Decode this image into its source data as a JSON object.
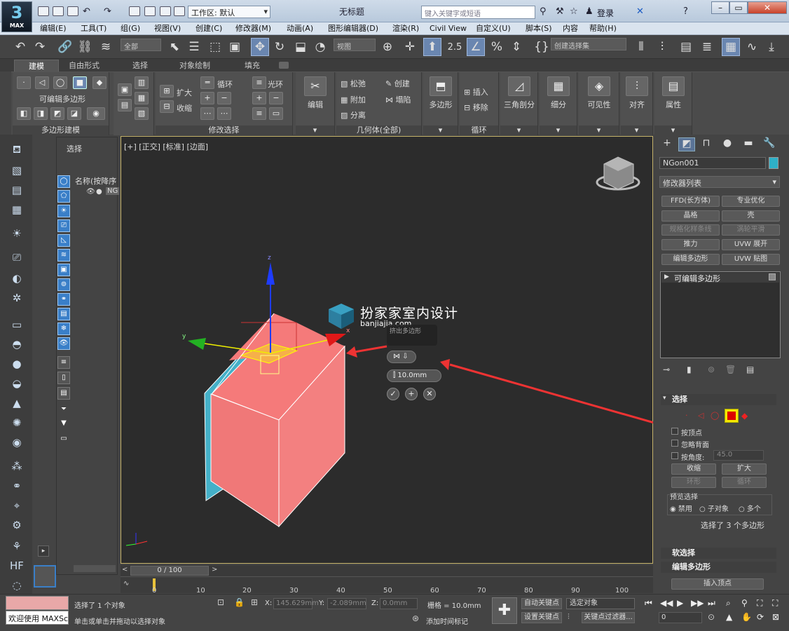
{
  "app": {
    "logo_text": "3",
    "logo_sub": "MAX",
    "window_title": "无标题",
    "workspace_label": "工作区: 默认"
  },
  "search": {
    "placeholder": "键入关键字或短语"
  },
  "user": {
    "login_label": "登录"
  },
  "menus": [
    "编辑(E)",
    "工具(T)",
    "组(G)",
    "视图(V)",
    "创建(C)",
    "修改器(M)",
    "动画(A)",
    "图形编辑器(D)",
    "渲染(R)",
    "Civil View",
    "自定义(U)",
    "脚本(S)",
    "内容",
    "帮助(H)"
  ],
  "toolbar": {
    "selection_filter": "全部",
    "ref_coord": "视图",
    "snap_angle": "2.5",
    "named_selection": "创建选择集"
  },
  "ribbon_tabs": [
    "建模",
    "自由形式",
    "选择",
    "对象绘制",
    "填充"
  ],
  "ribbon": {
    "editable_poly_label": "可编辑多边形",
    "poly_modeling_footer": "多边形建模",
    "grow_label": "扩大",
    "shrink_label": "收缩",
    "loop_label": "循环",
    "ring_label": "光环",
    "modify_selection_footer": "修改选择",
    "edit_label": "编辑",
    "relax_label": "松弛",
    "create_label": "创建",
    "attach_label": "附加",
    "collapse_label": "塌陷",
    "detach_label": "分离",
    "geometry_footer": "几何体(全部)",
    "polygon_label": "多边形",
    "insert_label": "插入",
    "remove_label": "移除",
    "loops_footer": "循环",
    "triangulate_label": "三角剖分",
    "subdivide_label": "细分",
    "visibility_label": "可见性",
    "align_label": "对齐",
    "properties_label": "属性"
  },
  "scene_explorer": {
    "title": "选择",
    "column_header": "名称(按降序",
    "item": "NG"
  },
  "viewport": {
    "label": "[+] [正交] [标准] [边面]",
    "caddy_title": "挤出多边形",
    "caddy_value": "10.0mm",
    "axis_x": "x",
    "axis_y": "y",
    "axis_z": "z"
  },
  "watermark": {
    "title": "扮家家室内设计",
    "url": "banjiajia.com"
  },
  "timeline": {
    "frame_display": "0 / 100",
    "ticks": [
      "0",
      "10",
      "20",
      "30",
      "40",
      "50",
      "60",
      "70",
      "80",
      "90",
      "100"
    ]
  },
  "command_panel": {
    "object_name": "NGon001",
    "object_color": "#2fb0c7",
    "modifier_list": "修改器列表",
    "modifier_buttons": [
      "FFD(长方体)",
      "专业优化",
      "晶格",
      "壳",
      "规格化样条线",
      "涡轮平滑",
      "推力",
      "UVW 展开",
      "编辑多边形",
      "UVW 贴图"
    ],
    "stack_item": "可编辑多边形",
    "selection_rollout": "选择",
    "by_vertex": "按顶点",
    "ignore_backfacing": "忽略背面",
    "by_angle": "按角度:",
    "angle_value": "45.0",
    "shrink_btn": "收缩",
    "grow_btn": "扩大",
    "ring_btn": "环形",
    "loop_btn": "循环",
    "preview_selection": "预览选择",
    "preview_options": [
      "禁用",
      "子对象",
      "多个"
    ],
    "selection_status": "选择了 3 个多边形",
    "soft_selection_rollout": "软选择",
    "edit_polygons_rollout": "编辑多边形",
    "insert_vertex_btn": "插入顶点"
  },
  "status": {
    "maxscript_text": "欢迎使用 MAXScr",
    "selected_text": "选择了 1 个对象",
    "prompt_text": "单击或单击并拖动以选择对象",
    "x_label": "X:",
    "x_value": "145.629mm",
    "y_label": "Y:",
    "y_value": "-2.089mm",
    "z_label": "Z:",
    "z_value": "0.0mm",
    "grid_text": "栅格 = 10.0mm",
    "add_time_tag": "添加时间标记",
    "auto_key": "自动关键点",
    "set_key": "设置关键点",
    "selected_object": "选定对象",
    "key_filters": "关键点过滤器...",
    "frame_value": "0"
  }
}
